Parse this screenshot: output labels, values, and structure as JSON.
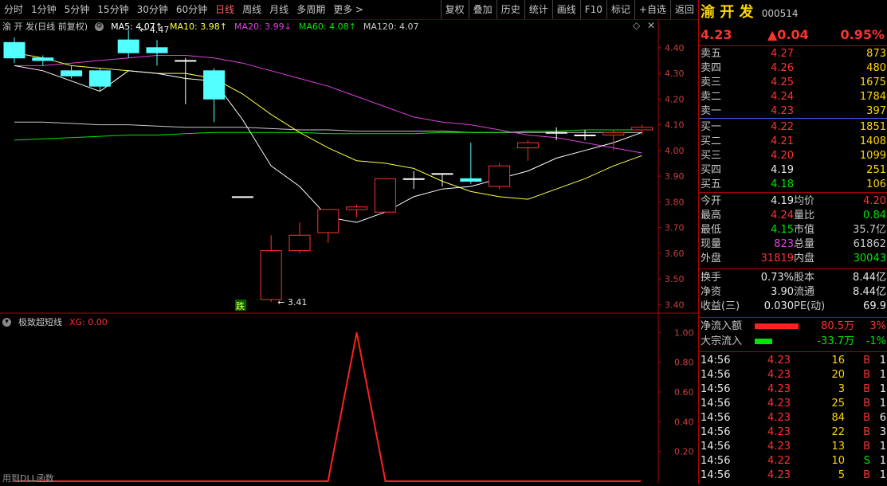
{
  "toolbar": {
    "periods": [
      "分时",
      "1分钟",
      "5分钟",
      "15分钟",
      "30分钟",
      "60分钟",
      "日线",
      "周线",
      "月线",
      "多周期",
      "更多 >"
    ],
    "active_period": "日线",
    "buttons": [
      "复权",
      "叠加",
      "历史",
      "统计",
      "画线",
      "F10",
      "标记",
      "+自选",
      "返回"
    ]
  },
  "main_legend": {
    "title": "渝 开 发(日线 前复权)",
    "ma5": "MA5: 4.07↑",
    "ma10": "MA10: 3.98↑",
    "ma20": "MA20: 3.99↓",
    "ma60": "MA60: 4.08↑",
    "ma120": "MA120: 4.07",
    "high_label": "4.47",
    "low_label": "3.41",
    "tag_label": "跌"
  },
  "sub_legend": {
    "title": "极致超短线",
    "xg": "XG: 0.00",
    "footer": "用到DLL函数"
  },
  "colors": {
    "up": "#ff3232",
    "down": "#54ffff",
    "ma5": "#ffffff",
    "ma10": "#ffff40",
    "ma20": "#e040e0",
    "ma60": "#00e600",
    "ma120": "#c8c8c8",
    "grid": "#800000"
  },
  "chart_data": {
    "type": "candlestick",
    "ylim": [
      3.37,
      4.48
    ],
    "yticks": [
      "4.40",
      "4.30",
      "4.20",
      "4.10",
      "4.00",
      "3.90",
      "3.80",
      "3.70",
      "3.60",
      "3.50",
      "3.40"
    ],
    "candles": [
      {
        "o": 4.42,
        "c": 4.36,
        "h": 4.44,
        "l": 4.34
      },
      {
        "o": 4.36,
        "c": 4.35,
        "h": 4.37,
        "l": 4.33
      },
      {
        "o": 4.31,
        "c": 4.29,
        "h": 4.33,
        "l": 4.28
      },
      {
        "o": 4.31,
        "c": 4.25,
        "h": 4.32,
        "l": 4.23
      },
      {
        "o": 4.43,
        "c": 4.38,
        "h": 4.47,
        "l": 4.36
      },
      {
        "o": 4.4,
        "c": 4.38,
        "h": 4.43,
        "l": 4.33
      },
      {
        "o": 4.35,
        "c": 4.35,
        "h": 4.36,
        "l": 4.18
      },
      {
        "o": 4.31,
        "c": 4.2,
        "h": 4.32,
        "l": 4.11
      },
      {
        "o": 3.82,
        "c": 3.82,
        "h": 3.82,
        "l": 3.82
      },
      {
        "o": 3.42,
        "c": 3.61,
        "h": 3.67,
        "l": 3.41
      },
      {
        "o": 3.61,
        "c": 3.67,
        "h": 3.72,
        "l": 3.6
      },
      {
        "o": 3.68,
        "c": 3.77,
        "h": 3.77,
        "l": 3.64
      },
      {
        "o": 3.77,
        "c": 3.78,
        "h": 3.79,
        "l": 3.74
      },
      {
        "o": 3.76,
        "c": 3.89,
        "h": 3.89,
        "l": 3.76
      },
      {
        "o": 3.89,
        "c": 3.89,
        "h": 3.92,
        "l": 3.85
      },
      {
        "o": 3.91,
        "c": 3.91,
        "h": 3.91,
        "l": 3.86
      },
      {
        "o": 3.89,
        "c": 3.88,
        "h": 4.03,
        "l": 3.87
      },
      {
        "o": 3.86,
        "c": 3.94,
        "h": 3.95,
        "l": 3.85
      },
      {
        "o": 4.01,
        "c": 4.03,
        "h": 4.04,
        "l": 3.96
      },
      {
        "o": 4.07,
        "c": 4.07,
        "h": 4.09,
        "l": 4.04
      },
      {
        "o": 4.06,
        "c": 4.06,
        "h": 4.08,
        "l": 4.04
      },
      {
        "o": 4.06,
        "c": 4.07,
        "h": 4.08,
        "l": 4.0
      },
      {
        "o": 4.08,
        "c": 4.09,
        "h": 4.1,
        "l": 4.06
      }
    ],
    "ma5": [
      4.33,
      4.31,
      4.27,
      4.23,
      4.31,
      4.3,
      4.28,
      4.27,
      4.12,
      3.94,
      3.86,
      3.74,
      3.72,
      3.76,
      3.82,
      3.85,
      3.86,
      3.89,
      3.92,
      3.97,
      4.0,
      4.03,
      4.07
    ],
    "ma10": [
      4.38,
      4.36,
      4.33,
      4.32,
      4.31,
      4.3,
      4.3,
      4.28,
      4.22,
      4.14,
      4.07,
      4.01,
      3.96,
      3.95,
      3.93,
      3.88,
      3.84,
      3.82,
      3.81,
      3.85,
      3.89,
      3.94,
      3.98
    ],
    "ma20": [
      4.33,
      4.33,
      4.34,
      4.35,
      4.36,
      4.37,
      4.37,
      4.36,
      4.34,
      4.31,
      4.28,
      4.25,
      4.21,
      4.17,
      4.13,
      4.11,
      4.1,
      4.08,
      4.06,
      4.05,
      4.03,
      4.01,
      3.99
    ],
    "ma60": [
      4.04,
      4.045,
      4.05,
      4.055,
      4.06,
      4.06,
      4.065,
      4.07,
      4.07,
      4.07,
      4.07,
      4.065,
      4.065,
      4.065,
      4.065,
      4.07,
      4.07,
      4.07,
      4.075,
      4.075,
      4.08,
      4.08,
      4.08
    ],
    "ma120": [
      4.11,
      4.11,
      4.105,
      4.1,
      4.1,
      4.095,
      4.09,
      4.09,
      4.09,
      4.085,
      4.08,
      4.08,
      4.075,
      4.075,
      4.075,
      4.075,
      4.07,
      4.07,
      4.07,
      4.07,
      4.07,
      4.07,
      4.07
    ],
    "sub": {
      "ylim": [
        0,
        1.05
      ],
      "yticks": [
        "1.00",
        "0.80",
        "0.60",
        "0.40",
        "0.20"
      ],
      "signal": [
        0,
        0,
        0,
        0,
        0,
        0,
        0,
        0,
        0,
        0,
        0,
        0,
        0,
        0,
        0,
        0,
        0,
        0,
        0,
        0,
        0,
        0,
        0
      ],
      "spike_index": 12,
      "spike_value": 1.0
    }
  },
  "panel": {
    "name": "渝 开 发",
    "code": "000514",
    "price": "4.23",
    "change": "▲0.04",
    "pct": "0.95%",
    "sells": [
      {
        "label": "卖五",
        "price": "4.27",
        "vol": "873"
      },
      {
        "label": "卖四",
        "price": "4.26",
        "vol": "480"
      },
      {
        "label": "卖三",
        "price": "4.25",
        "vol": "1675"
      },
      {
        "label": "卖二",
        "price": "4.24",
        "vol": "1784"
      },
      {
        "label": "卖一",
        "price": "4.23",
        "vol": "397"
      }
    ],
    "buys": [
      {
        "label": "买一",
        "price": "4.22",
        "vol": "1851",
        "pc": "red"
      },
      {
        "label": "买二",
        "price": "4.21",
        "vol": "1408",
        "pc": "red"
      },
      {
        "label": "买三",
        "price": "4.20",
        "vol": "1099",
        "pc": "red"
      },
      {
        "label": "买四",
        "price": "4.19",
        "vol": "251",
        "pc": "white"
      },
      {
        "label": "买五",
        "price": "4.18",
        "vol": "106",
        "pc": "green"
      }
    ],
    "stats": [
      {
        "l1": "今开",
        "v1": "4.19",
        "c1": "white",
        "l2": "均价",
        "v2": "4.20",
        "c2": "red"
      },
      {
        "l1": "最高",
        "v1": "4.24",
        "c1": "red",
        "l2": "量比",
        "v2": "0.84",
        "c2": "green"
      },
      {
        "l1": "最低",
        "v1": "4.15",
        "c1": "green",
        "l2": "市值",
        "v2": "35.7亿",
        "c2": "gray"
      },
      {
        "l1": "现量",
        "v1": "823",
        "c1": "magenta",
        "l2": "总量",
        "v2": "61862",
        "c2": "gray"
      },
      {
        "l1": "外盘",
        "v1": "31819",
        "c1": "red",
        "l2": "内盘",
        "v2": "30043",
        "c2": "green"
      }
    ],
    "stats2": [
      {
        "l1": "换手",
        "v1": "0.73%",
        "l2": "股本",
        "v2": "8.44亿"
      },
      {
        "l1": "净资",
        "v1": "3.90",
        "l2": "流通",
        "v2": "8.44亿"
      },
      {
        "l1": "收益(三)",
        "v1": "0.030",
        "l2": "PE(动)",
        "v2": "69.9"
      }
    ],
    "flows": [
      {
        "label": "净流入额",
        "value": "80.5万",
        "pct": "3%",
        "color": "red",
        "bar": 55
      },
      {
        "label": "大宗流入",
        "value": "-33.7万",
        "pct": "-1%",
        "color": "green",
        "bar": 22
      }
    ],
    "ticks": [
      {
        "t": "14:56",
        "p": "4.23",
        "v": "16",
        "s": "B",
        "n": "1"
      },
      {
        "t": "14:56",
        "p": "4.23",
        "v": "20",
        "s": "B",
        "n": "1"
      },
      {
        "t": "14:56",
        "p": "4.23",
        "v": "3",
        "s": "B",
        "n": "1"
      },
      {
        "t": "14:56",
        "p": "4.23",
        "v": "25",
        "s": "B",
        "n": "1"
      },
      {
        "t": "14:56",
        "p": "4.23",
        "v": "84",
        "s": "B",
        "n": "6"
      },
      {
        "t": "14:56",
        "p": "4.23",
        "v": "22",
        "s": "B",
        "n": "3"
      },
      {
        "t": "14:56",
        "p": "4.23",
        "v": "13",
        "s": "B",
        "n": "1"
      },
      {
        "t": "14:56",
        "p": "4.22",
        "v": "10",
        "s": "S",
        "n": "1"
      },
      {
        "t": "14:56",
        "p": "4.23",
        "v": "5",
        "s": "B",
        "n": "1"
      }
    ]
  }
}
